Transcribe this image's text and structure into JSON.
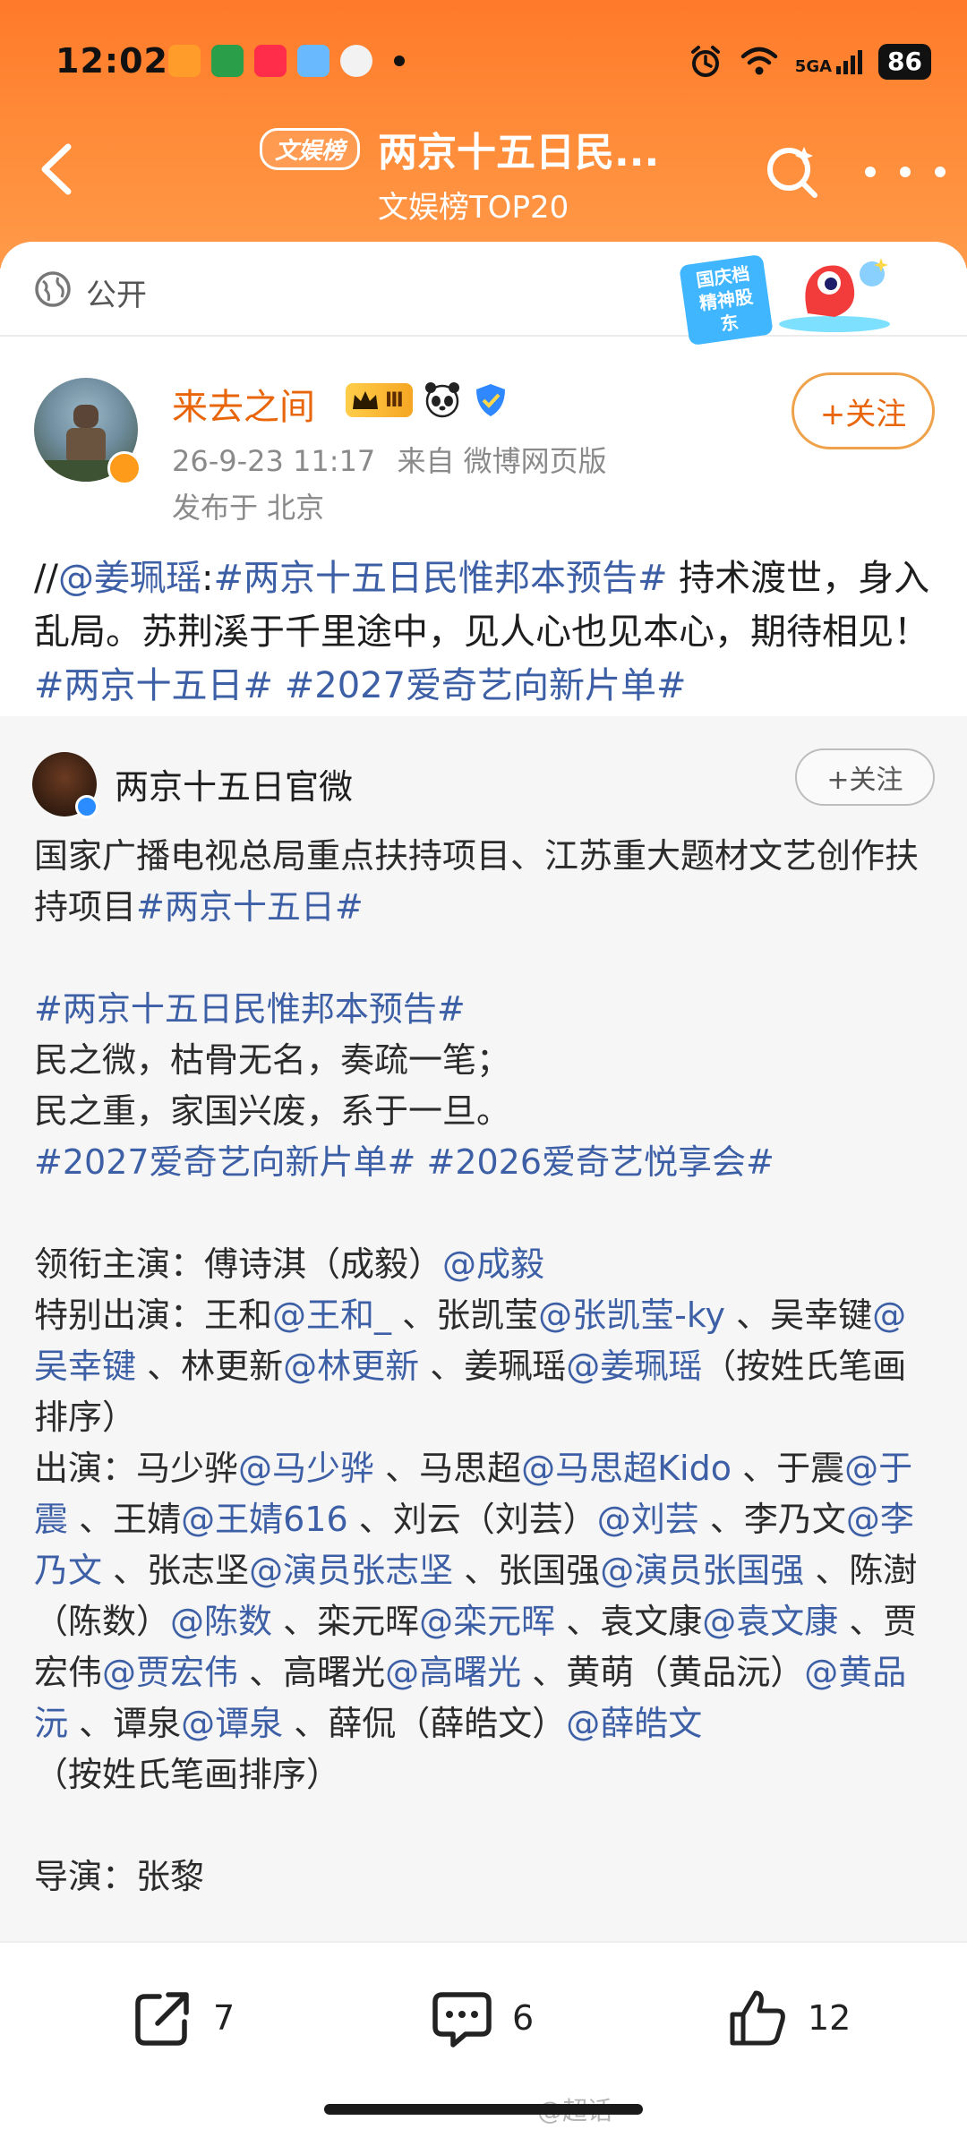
{
  "status_bar": {
    "time": "12:02",
    "network": "5GA",
    "battery": "86"
  },
  "header": {
    "tag": "文娱榜",
    "title": "两京十五日民...",
    "subtitle": "文娱榜TOP20"
  },
  "visibility": {
    "label": "公开"
  },
  "banner": {
    "text": "国庆档 精神股东"
  },
  "post": {
    "author": "来去之间",
    "level_badge": "Ⅲ",
    "time": "26-9-23 11:17",
    "source": "来自 微博网页版",
    "location": "发布于 北京",
    "follow_label": "+关注",
    "text": {
      "prefix": "//",
      "mention": "@姜珮瑶",
      "colon": ":",
      "topic1": "#两京十五日民惟邦本预告#",
      "body": " 持术渡世，身入乱局。苏荆溪于千里途中，见人心也见本心，期待相见！",
      "topic2": "#两京十五日#",
      "topic3": "#2027爱奇艺向新片单#"
    }
  },
  "repost": {
    "author": "两京十五日官微",
    "follow_label": "+关注",
    "p1": "国家广播电视总局重点扶持项目、江苏重大题材文艺创作扶持项目",
    "p1_topic": "#两京十五日#",
    "topic_a": "#两京十五日民惟邦本预告#",
    "line_a": "民之微，枯骨无名，奏疏一笔；",
    "line_b": "民之重，家国兴废，系于一旦。",
    "topic_b": "#2027爱奇艺向新片单#",
    "topic_c": "#2026爱奇艺悦享会#",
    "lead_label": "领衔主演：傅诗淇（成毅）",
    "lead_mention": "@成毅",
    "special_label": "特别出演：王和",
    "special_m1": "@王和_",
    "special_t2": " 、张凯莹",
    "special_m2": "@张凯莹-ky",
    "special_t3": " 、吴幸键",
    "special_m3": "@吴幸键",
    "special_t4": " 、林更新",
    "special_m4": "@林更新",
    "special_t5": " 、姜珮瑶",
    "special_m5": "@姜珮瑶",
    "special_t6": "（按姓氏笔画排序）",
    "cast_label": "出演：马少骅",
    "cast_m1": "@马少骅",
    "cast_t2": " 、马思超",
    "cast_m2": "@马思超Kido",
    "cast_t3": " 、于震",
    "cast_m3": "@于震",
    "cast_t4": " 、王婧",
    "cast_m4": "@王婧616",
    "cast_t5": " 、刘云（刘芸）",
    "cast_m5": "@刘芸",
    "cast_t6": " 、李乃文",
    "cast_m6": "@李乃文",
    "cast_t7": " 、张志坚",
    "cast_m7": "@演员张志坚",
    "cast_t8": " 、张国强",
    "cast_m8": "@演员张国强",
    "cast_t9": " 、陈澍（陈数）",
    "cast_m9": "@陈数",
    "cast_t10": " 、栾元晖",
    "cast_m10": "@栾元晖",
    "cast_t11": " 、袁文康",
    "cast_m11": "@袁文康",
    "cast_t12": " 、贾宏伟",
    "cast_m12": "@贾宏伟",
    "cast_t13": " 、高曙光",
    "cast_m13": "@高曙光",
    "cast_t14": " 、黄萌（黄品沅）",
    "cast_m14": "@黄品沅",
    "cast_t15": " 、谭泉",
    "cast_m15": "@谭泉",
    "cast_t16": " 、薛侃（薛皓文）",
    "cast_m16": "@薛皓文",
    "cast_note": "（按姓氏笔画排序）",
    "director_partial": "导演：张黎"
  },
  "actions": {
    "repost_count": "7",
    "comment_count": "6",
    "like_count": "12"
  },
  "watermark": "@超话"
}
